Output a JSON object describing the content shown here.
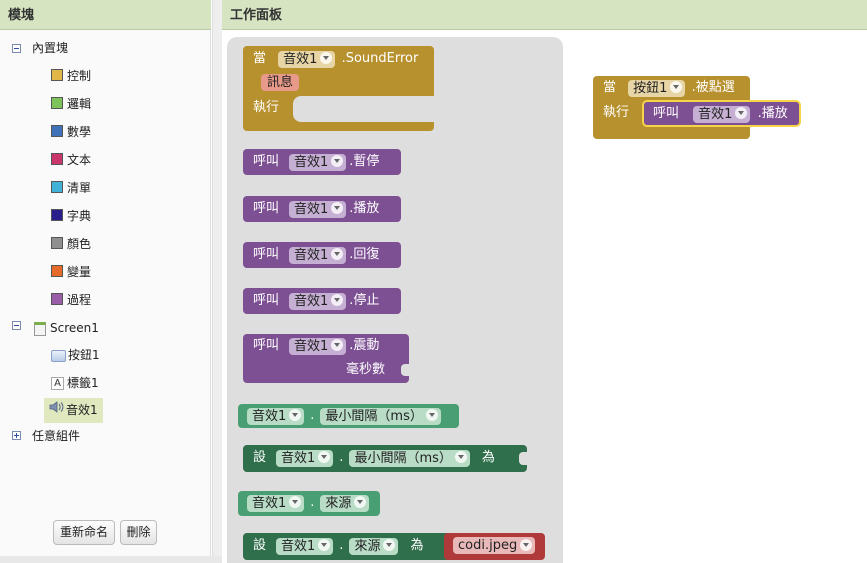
{
  "left_panel": {
    "title": "模塊",
    "builtin": {
      "label": "內置塊",
      "items": [
        {
          "label": "控制",
          "color": "#e1b847"
        },
        {
          "label": "邏輯",
          "color": "#7ec35a"
        },
        {
          "label": "數學",
          "color": "#3f72b8"
        },
        {
          "label": "文本",
          "color": "#c8366b"
        },
        {
          "label": "清單",
          "color": "#42b1d8"
        },
        {
          "label": "字典",
          "color": "#2a1e8c"
        },
        {
          "label": "顏色",
          "color": "#8f8f8f"
        },
        {
          "label": "變量",
          "color": "#e66a2a"
        },
        {
          "label": "過程",
          "color": "#9a5ea8"
        }
      ]
    },
    "screen": {
      "label": "Screen1",
      "items": [
        {
          "label": "按鈕1",
          "icon": "button-icon"
        },
        {
          "label": "標籤1",
          "icon": "label-icon"
        },
        {
          "label": "音效1",
          "icon": "sound-icon"
        }
      ]
    },
    "any_component": "任意組件",
    "rename_button": "重新命名",
    "delete_button": "刪除"
  },
  "workspace": {
    "title": "工作面板",
    "flyout_blocks": {
      "sound_error": {
        "when": "當",
        "component": "音效1",
        "event": ".SoundError",
        "param": "訊息",
        "do": "執行"
      },
      "call": "呼叫",
      "methods": [
        ".暫停",
        ".播放",
        ".回復",
        ".停止",
        ".震動"
      ],
      "vibrate_param": "毫秒數",
      "get_interval": {
        "component": "音效1",
        "dot": ".",
        "property": "最小間隔（ms）"
      },
      "set_interval": {
        "set": "設",
        "component": "音效1",
        "dot": ".",
        "property": "最小間隔（ms）",
        "to": "為"
      },
      "get_source": {
        "component": "音效1",
        "dot": ".",
        "property": "來源"
      },
      "set_source": {
        "set": "設",
        "component": "音效1",
        "dot": ".",
        "property": "來源",
        "to": "為",
        "value": "codi.jpeg"
      }
    },
    "main_block": {
      "when": "當",
      "component": "按鈕1",
      "event": ".被點選",
      "do": "執行",
      "call": "呼叫",
      "call_component": "音效1",
      "call_method": ".播放"
    }
  },
  "colors": {
    "event": "#b8912f",
    "method": "#7d4f93",
    "getter": "#4a9e74",
    "setter": "#2f6f4b",
    "text": "#b03a3a",
    "dropdown_event": "#e8d5a6",
    "dropdown_method": "#c5afd2",
    "dropdown_getter": "#b8dcc6",
    "dropdown_text": "#e9b9b9",
    "param": "#e79a8a",
    "selected": "#f6d44a"
  }
}
